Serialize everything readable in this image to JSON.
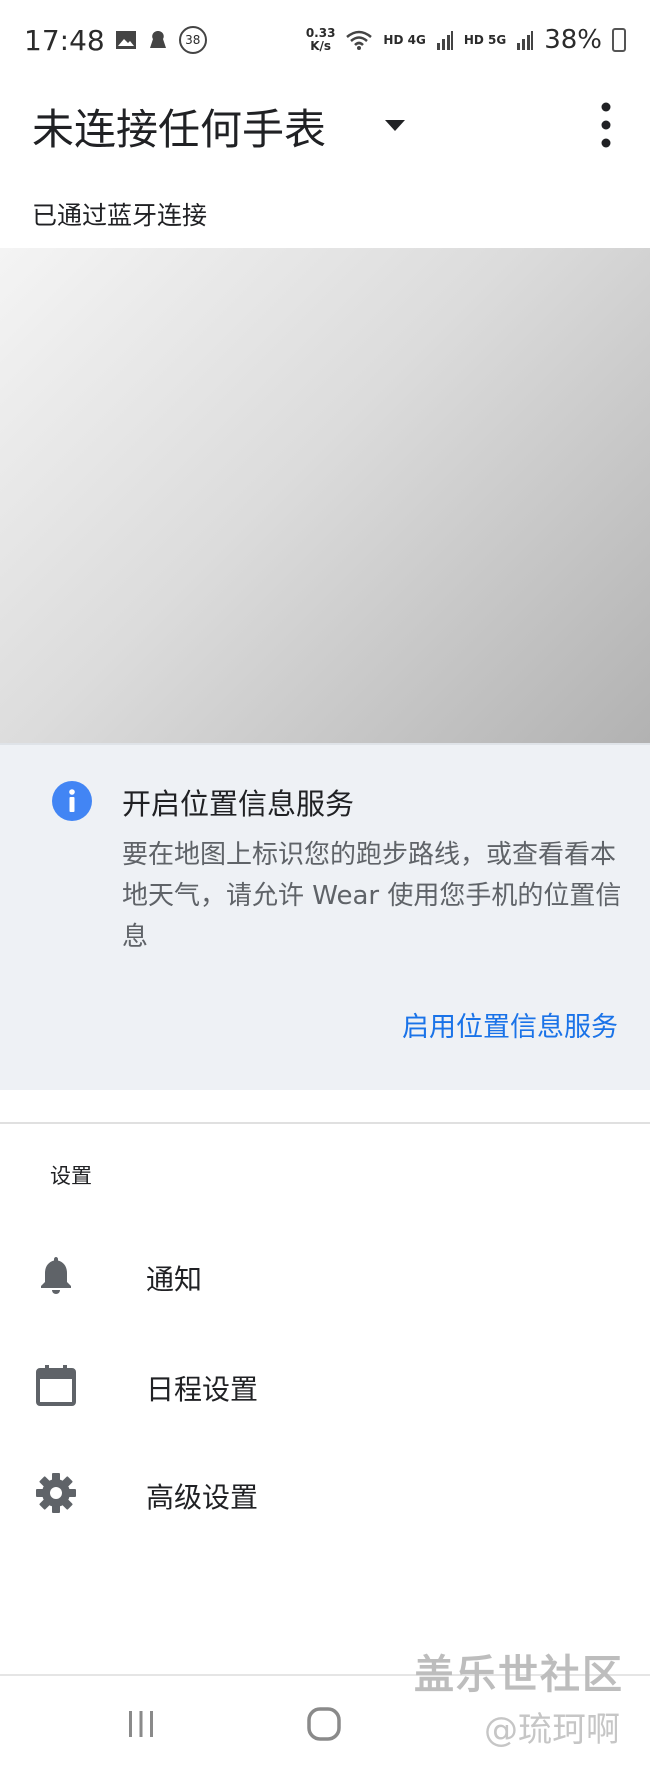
{
  "status_bar": {
    "time": "17:48",
    "notification_badge": "38",
    "net_speed_value": "0.33",
    "net_speed_unit": "K/s",
    "network_1": "HD 4G",
    "network_2": "HD 5G",
    "battery": "38%",
    "icons": [
      "image-icon",
      "app-notification-icon",
      "wifi-icon",
      "signal-icon",
      "battery-icon"
    ]
  },
  "app_bar": {
    "title": "未连接任何手表",
    "dropdown_icon": "arrow-drop-down-icon",
    "menu_icon": "more-vert-icon"
  },
  "connection_status": "已通过蓝牙连接",
  "location_card": {
    "icon": "info-icon",
    "title": "开启位置信息服务",
    "body": "要在地图上标识您的跑步路线，或查看看本地天气，请允许 Wear 使用您手机的位置信息",
    "action": "启用位置信息服务"
  },
  "settings": {
    "section_label": "设置",
    "items": [
      {
        "label": "通知",
        "icon": "bell-icon"
      },
      {
        "label": "日程设置",
        "icon": "calendar-icon"
      },
      {
        "label": "高级设置",
        "icon": "gear-icon"
      }
    ]
  },
  "nav_bar": {
    "icons": [
      "recent-apps-icon",
      "home-icon"
    ]
  },
  "watermark": {
    "title": "盖乐世社区",
    "author": "@琉珂啊"
  },
  "colors": {
    "accent": "#1a73e8",
    "card_background": "#eef1f5",
    "text_primary": "#202124",
    "text_secondary": "#5f6368",
    "info_icon": "#4285f4"
  }
}
